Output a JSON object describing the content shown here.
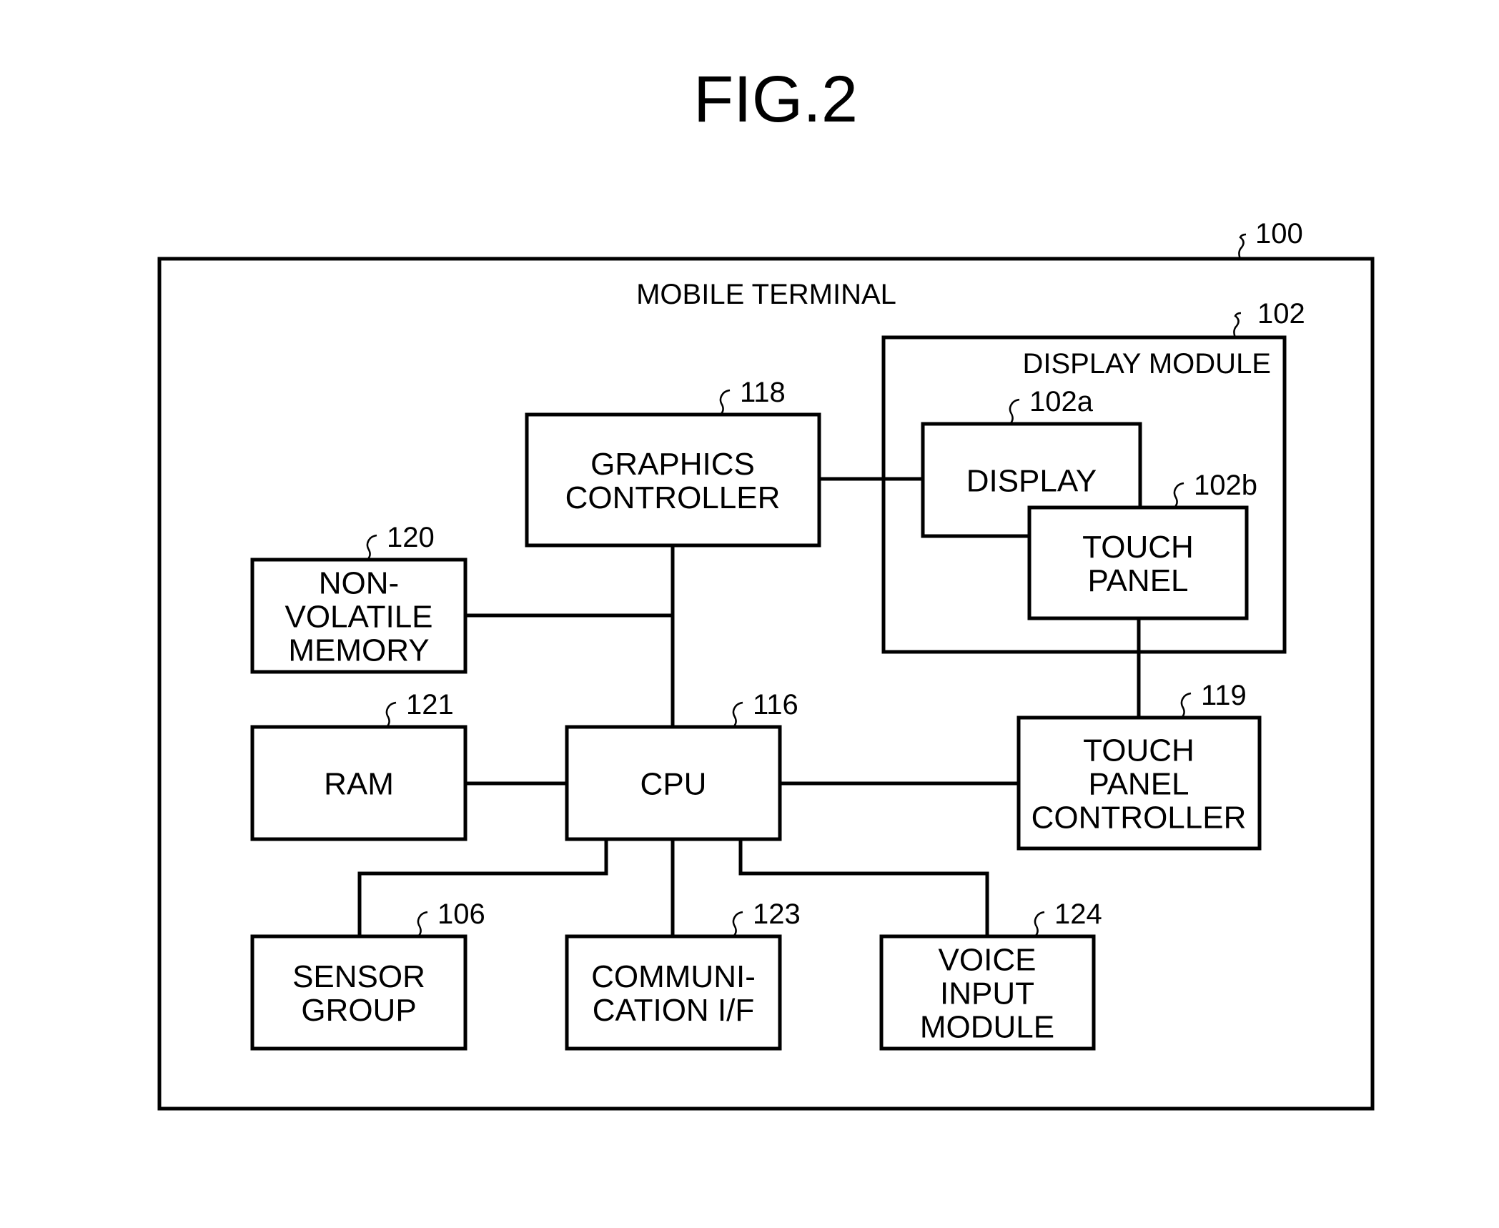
{
  "figure": {
    "title": "FIG.2",
    "outer": {
      "ref": "100",
      "label": "MOBILE TERMINAL"
    },
    "display_module": {
      "ref": "102",
      "label": "DISPLAY MODULE"
    },
    "blocks": [
      {
        "id": "display",
        "ref": "102a",
        "lines": [
          "DISPLAY"
        ]
      },
      {
        "id": "touch-panel",
        "ref": "102b",
        "lines": [
          "TOUCH",
          "PANEL"
        ]
      },
      {
        "id": "graphics-controller",
        "ref": "118",
        "lines": [
          "GRAPHICS",
          "CONTROLLER"
        ]
      },
      {
        "id": "non-volatile-memory",
        "ref": "120",
        "lines": [
          "NON-",
          "VOLATILE",
          "MEMORY"
        ]
      },
      {
        "id": "ram",
        "ref": "121",
        "lines": [
          "RAM"
        ]
      },
      {
        "id": "cpu",
        "ref": "116",
        "lines": [
          "CPU"
        ]
      },
      {
        "id": "touch-panel-controller",
        "ref": "119",
        "lines": [
          "TOUCH",
          "PANEL",
          "CONTROLLER"
        ]
      },
      {
        "id": "sensor-group",
        "ref": "106",
        "lines": [
          "SENSOR",
          "GROUP"
        ]
      },
      {
        "id": "communication-if",
        "ref": "123",
        "lines": [
          "COMMUNI-",
          "CATION I/F"
        ]
      },
      {
        "id": "voice-input-module",
        "ref": "124",
        "lines": [
          "VOICE",
          "INPUT",
          "MODULE"
        ]
      }
    ]
  }
}
